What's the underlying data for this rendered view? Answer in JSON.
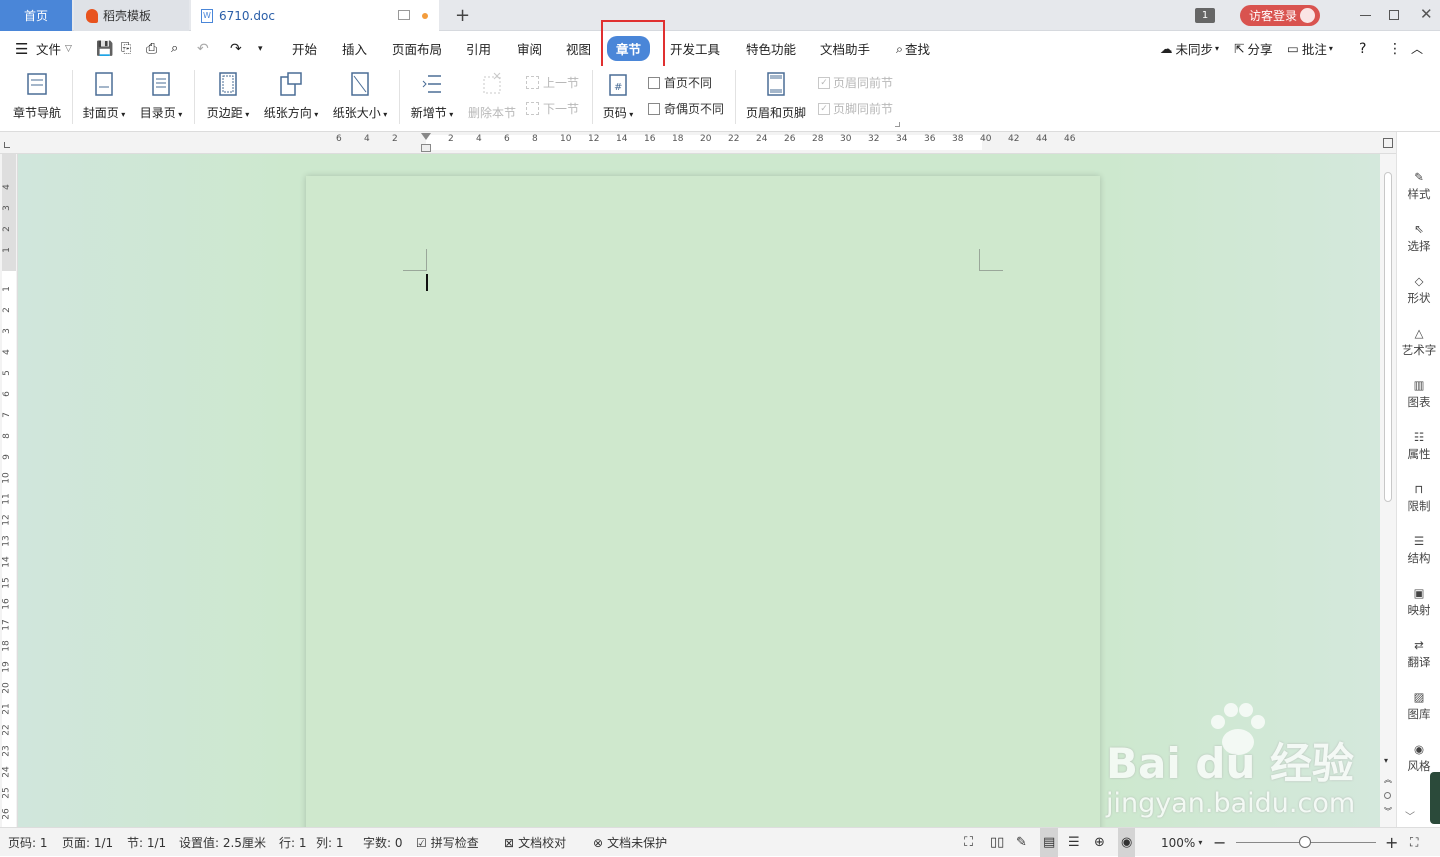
{
  "tabs": {
    "home": "首页",
    "template": "稻壳模板",
    "document": "6710.doc",
    "window_count": "1",
    "login": "访客登录"
  },
  "menu": {
    "file": "文件",
    "tabs": [
      "开始",
      "插入",
      "页面布局",
      "引用",
      "审阅",
      "视图",
      "章节",
      "开发工具",
      "特色功能",
      "文档助手"
    ],
    "active_tab": "章节",
    "find": "查找",
    "sync": "未同步",
    "share": "分享",
    "comment": "批注"
  },
  "ribbon": {
    "chapter_nav": "章节导航",
    "cover": "封面页",
    "toc": "目录页",
    "margins": "页边距",
    "orientation": "纸张方向",
    "paper_size": "纸张大小",
    "new_section": "新增节",
    "delete_section": "删除本节",
    "prev_section": "上一节",
    "next_section": "下一节",
    "page_number": "页码",
    "first_page_diff": "首页不同",
    "odd_even_diff": "奇偶页不同",
    "header_footer": "页眉和页脚",
    "header_same_prev": "页眉同前节",
    "footer_same_prev": "页脚同前节"
  },
  "ruler": {
    "h_labels": [
      "6",
      "4",
      "2",
      "2",
      "4",
      "6",
      "8",
      "10",
      "12",
      "14",
      "16",
      "18",
      "20",
      "22",
      "24",
      "26",
      "28",
      "30",
      "32",
      "34",
      "36",
      "38",
      "40",
      "42",
      "44",
      "46"
    ],
    "v_labels_top": [
      "4",
      "3",
      "2",
      "1"
    ],
    "v_labels": [
      "1",
      "2",
      "3",
      "4",
      "5",
      "6",
      "7",
      "8",
      "9",
      "10",
      "11",
      "12",
      "13",
      "14",
      "15",
      "16",
      "17",
      "18",
      "19",
      "20",
      "21",
      "22",
      "23",
      "24",
      "25",
      "26"
    ]
  },
  "right_panel": [
    "样式",
    "选择",
    "形状",
    "艺术字",
    "图表",
    "属性",
    "限制",
    "结构",
    "映射",
    "翻译",
    "图库",
    "风格"
  ],
  "status": {
    "page_num": "页码: 1",
    "pages": "页面: 1/1",
    "section": "节: 1/1",
    "setting": "设置值: 2.5厘米",
    "row": "行: 1",
    "col": "列: 1",
    "words": "字数: 0",
    "spell": "拼写检查",
    "proof": "文档校对",
    "protect": "文档未保护",
    "zoom": "100%"
  },
  "watermark": {
    "brand": "Bai du 经验",
    "url": "jingyan.baidu.com"
  },
  "colors": {
    "accent": "#4a86d8",
    "highlight_box": "#e03030",
    "page_bg": "#cfe8cd",
    "login_bg": "#d9534f"
  }
}
